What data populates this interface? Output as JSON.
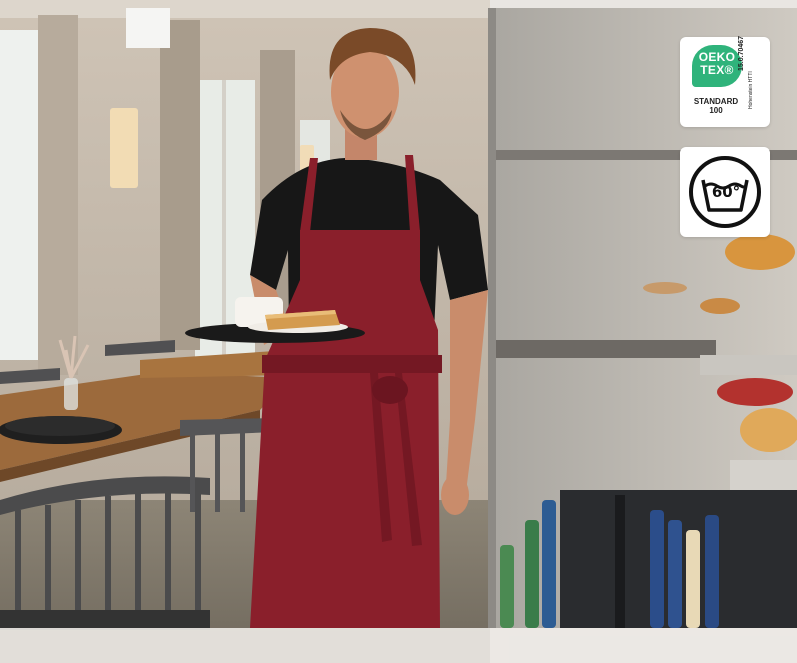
{
  "scene": {
    "subject": "waiter-in-burgundy-bib-apron",
    "accent_colors": {
      "apron": "#8a1f2b",
      "shirt": "#161616",
      "oeko_green": "#2fb37b"
    }
  },
  "badges": {
    "oeko": {
      "brand_line1": "OEKO",
      "brand_line2": "TEX®",
      "standard_label": "STANDARD",
      "standard_number": "100",
      "certificate": "15.0.70467",
      "institute": "Hohenstein HTTI"
    },
    "wash": {
      "temperature_label": "60°",
      "icon": "wash-basin-icon"
    }
  }
}
